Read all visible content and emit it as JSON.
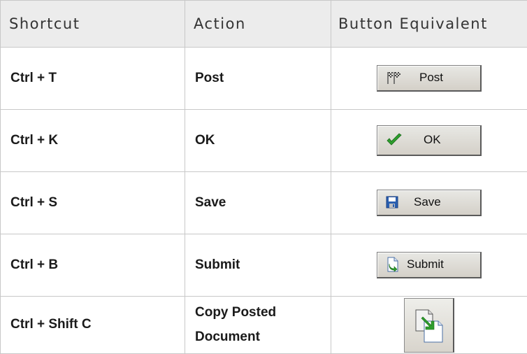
{
  "headers": {
    "shortcut": "Shortcut",
    "action": "Action",
    "button_equivalent": "Button Equivalent"
  },
  "rows": [
    {
      "shortcut": "Ctrl + T",
      "action": "Post",
      "button_label": "Post",
      "icon": "checkered-flag-icon"
    },
    {
      "shortcut": "Ctrl + K",
      "action": "OK",
      "button_label": "OK",
      "icon": "green-checkmark-icon"
    },
    {
      "shortcut": "Ctrl + S",
      "action": "Save",
      "button_label": "Save",
      "icon": "floppy-disk-icon"
    },
    {
      "shortcut": "Ctrl + B",
      "action": "Submit",
      "button_label": "Submit",
      "icon": "document-arrow-icon"
    },
    {
      "shortcut": "Ctrl + Shift C",
      "action_lines": [
        "Copy Posted",
        "Document"
      ],
      "button_label": "",
      "icon": "copy-document-icon"
    }
  ],
  "colors": {
    "header_bg": "#ececec",
    "border": "#c8c8c8",
    "button_face": "#d4d0c8",
    "check_green": "#2e9e2e",
    "floppy_blue": "#2a5fb0"
  }
}
